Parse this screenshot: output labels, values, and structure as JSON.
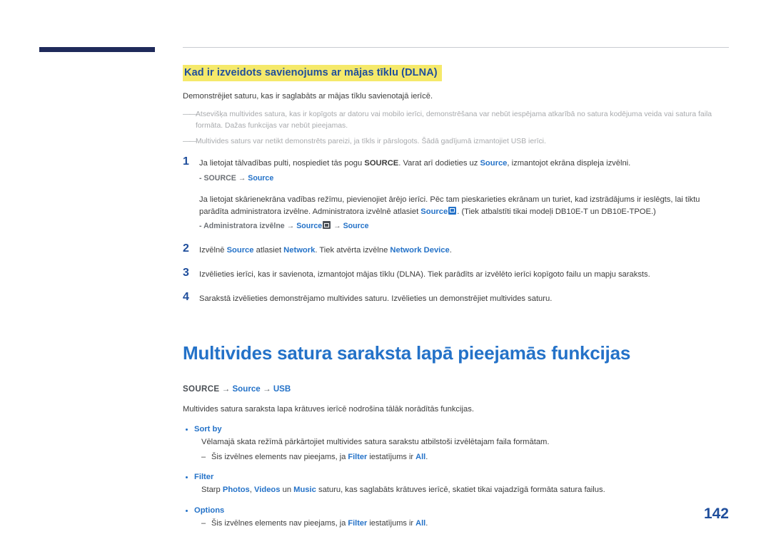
{
  "section": {
    "heading": "Kad ir izveidots savienojums ar mājas tīklu (DLNA)",
    "intro": "Demonstrējiet saturu, kas ir saglabāts ar mājas tīklu savienotajā ierīcē.",
    "notes": [
      "Atsevišķa multivides satura, kas ir kopīgots ar datoru vai mobilo ierīci, demonstrēšana var nebūt iespējama atkarībā no satura kodējuma veida vai satura faila formāta. Dažas funkcijas var nebūt pieejamas.",
      "Multivides saturs var netikt demonstrēts pareizi, ja tīkls ir pārslogots. Šādā gadījumā izmantojiet USB ierīci."
    ]
  },
  "steps": [
    {
      "num": "1",
      "text_parts": {
        "p1": "Ja lietojat tālvadības pulti, nospiediet tās pogu ",
        "src": "SOURCE",
        "p2": ". Varat arī dodieties uz ",
        "source": "Source",
        "p3": ", izmantojot ekrāna displeja izvēlni."
      },
      "path": {
        "prefix": "- ",
        "label": "SOURCE",
        "arrow": " → ",
        "target": "Source"
      },
      "extra": {
        "p1": "Ja lietojat skārienekrāna vadības režīmu, pievienojiet ārējo ierīci. Pēc tam pieskarieties ekrānam un turiet, kad izstrādājums ir ieslēgts, lai tiktu parādīta administratora izvēlne. Administratora izvēlnē atlasiet ",
        "source1": "Source",
        "p2": ". (Tiek atbalstīti tikai modeļi DB10E-T un DB10E-TPOE.)"
      },
      "path2": {
        "prefix": "- Administratora izvēlne → ",
        "source": "Source",
        "arrow": " → ",
        "target": "Source"
      }
    },
    {
      "num": "2",
      "parts": {
        "p1": "Izvēlnē ",
        "b1": "Source",
        "p2": " atlasiet ",
        "b2": "Network",
        "p3": ". Tiek atvērta izvēlne ",
        "b3": "Network Device",
        "p4": "."
      }
    },
    {
      "num": "3",
      "text": "Izvēlieties ierīci, kas ir savienota, izmantojot mājas tīklu (DLNA). Tiek parādīts ar izvēlēto ierīci kopīgoto failu un mapju saraksts."
    },
    {
      "num": "4",
      "text": "Sarakstā izvēlieties demonstrējamo multivides saturu. Izvēlieties un demonstrējiet multivides saturu."
    }
  ],
  "big_section": {
    "title": "Multivides satura saraksta lapā pieejamās funkcijas",
    "path": {
      "label": "SOURCE",
      "arrow1": " → ",
      "source": "Source",
      "arrow2": " → ",
      "usb": "USB"
    },
    "intro": "Multivides satura saraksta lapa krātuves ierīcē nodrošina tālāk norādītās funkcijas.",
    "items": [
      {
        "label": "Sort by",
        "body": "Vēlamajā skata režīmā pārkārtojiet multivides satura sarakstu atbilstoši izvēlētajam faila formātam.",
        "note": {
          "p1": "Šis izvēlnes elements nav pieejams, ja ",
          "b1": "Filter",
          "p2": " iestatījums ir ",
          "b2": "All",
          "p3": "."
        }
      },
      {
        "label": "Filter",
        "body_parts": {
          "p1": "Starp ",
          "b1": "Photos",
          "p2": ", ",
          "b2": "Videos",
          "p3": " un ",
          "b3": "Music",
          "p4": " saturu, kas saglabāts krātuves ierīcē, skatiet tikai vajadzīgā formāta satura failus."
        }
      },
      {
        "label": "Options",
        "note": {
          "p1": "Šis izvēlnes elements nav pieejams, ja ",
          "b1": "Filter",
          "p2": " iestatījums ir ",
          "b2": "All",
          "p3": "."
        }
      }
    ]
  },
  "page_number": "142",
  "colors": {
    "accent_blue": "#2472c8",
    "highlight_yellow": "#f5e96a",
    "dark_navy": "#1f2a5a"
  }
}
